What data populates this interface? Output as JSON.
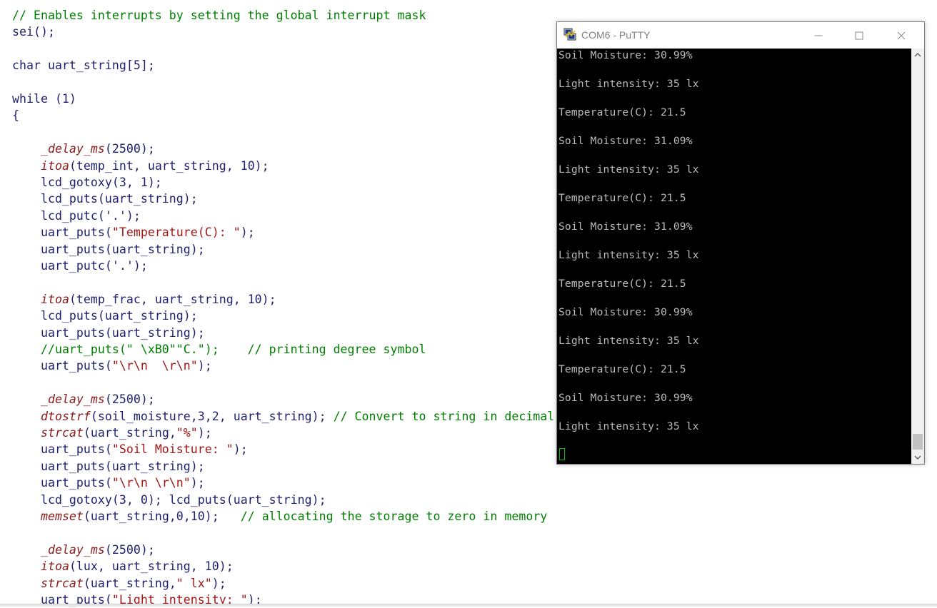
{
  "editor": {
    "lines": [
      "// Enables interrupts by setting the global interrupt mask",
      "sei();",
      "",
      "char uart_string[5];",
      "",
      "while (1)",
      "{",
      "",
      "    _delay_ms(2500);",
      "    itoa(temp_int, uart_string, 10);",
      "    lcd_gotoxy(3, 1);",
      "    lcd_puts(uart_string);",
      "    lcd_putc('.');",
      "    uart_puts(\"Temperature(C): \");",
      "    uart_puts(uart_string);",
      "    uart_putc('.');",
      "",
      "    itoa(temp_frac, uart_string, 10);",
      "    lcd_puts(uart_string);",
      "    uart_puts(uart_string);",
      "    //uart_puts(\" \\xB0\"\"C.\");    // printing degree symbol",
      "    uart_puts(\"\\r\\n  \\r\\n\");",
      "",
      "    _delay_ms(2500);",
      "    dtostrf(soil_moisture,3,2, uart_string); // Convert to string in decimal",
      "    strcat(uart_string,\"%\");",
      "    uart_puts(\"Soil Moisture: \");",
      "    uart_puts(uart_string);",
      "    uart_puts(\"\\r\\n \\r\\n\");",
      "    lcd_gotoxy(3, 0); lcd_puts(uart_string);",
      "    memset(uart_string,0,10);   // allocating the storage to zero in memory",
      "",
      "    _delay_ms(2500);",
      "    itoa(lux, uart_string, 10);",
      "    strcat(uart_string,\" lx\");",
      "    uart_puts(\"Light intensity: \");"
    ]
  },
  "putty": {
    "title": "COM6 - PuTTY",
    "icon": "putty-icon",
    "lines": [
      "Soil Moisture: 30.99%",
      "Light intensity: 35 lx",
      "Temperature(C): 21.5",
      "Soil Moisture: 31.09%",
      "Light intensity: 35 lx",
      "Temperature(C): 21.5",
      "Soil Moisture: 31.09%",
      "Light intensity: 35 lx",
      "Temperature(C): 21.5",
      "Soil Moisture: 30.99%",
      "Light intensity: 35 lx",
      "Temperature(C): 21.5",
      "Soil Moisture: 30.99%",
      "Light intensity: 35 lx"
    ],
    "colors": {
      "terminal_bg": "#000000",
      "terminal_fg": "#bbbbbb",
      "cursor": "#00c000"
    }
  }
}
